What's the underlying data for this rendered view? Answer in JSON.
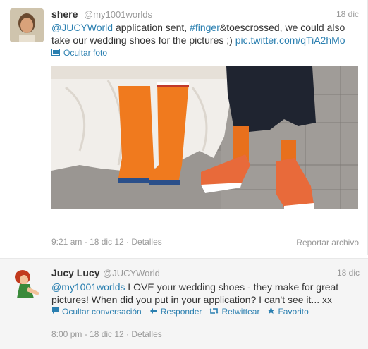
{
  "tweets": [
    {
      "name": "shere",
      "handle": "@my1001worlds",
      "date": "18 dic",
      "text_parts": [
        "@JUCYWorld",
        " application sent, ",
        "#finger",
        "&toescrossed, we could also take our wedding shoes for the pictures ;) ",
        "pic.twitter.com/qTiA2hMo"
      ],
      "hide_photo": "Ocultar foto",
      "timestamp": "9:21 am - 18 dic 12 · Detalles",
      "report": "Reportar archivo"
    },
    {
      "name": "Jucy Lucy",
      "handle": "@JUCYWorld",
      "date": "18 dic",
      "text_parts": [
        "@my1001worlds",
        " LOVE your wedding shoes - they make for great pictures! When did you put in your application? I can't see it... xx"
      ],
      "actions": [
        "Ocultar conversación",
        "Responder",
        "Retwittear",
        "Favorito"
      ],
      "timestamp": "8:00 pm - 18 dic 12 · Detalles"
    }
  ],
  "icons": {
    "photo": "photo-icon",
    "conversation": "speech-bubble-icon",
    "reply": "reply-arrow-icon",
    "retweet": "retweet-icon",
    "favorite": "star-icon"
  },
  "colors": {
    "link": "#2a7fb0",
    "muted": "#999999",
    "boots": "#f07a1e"
  }
}
